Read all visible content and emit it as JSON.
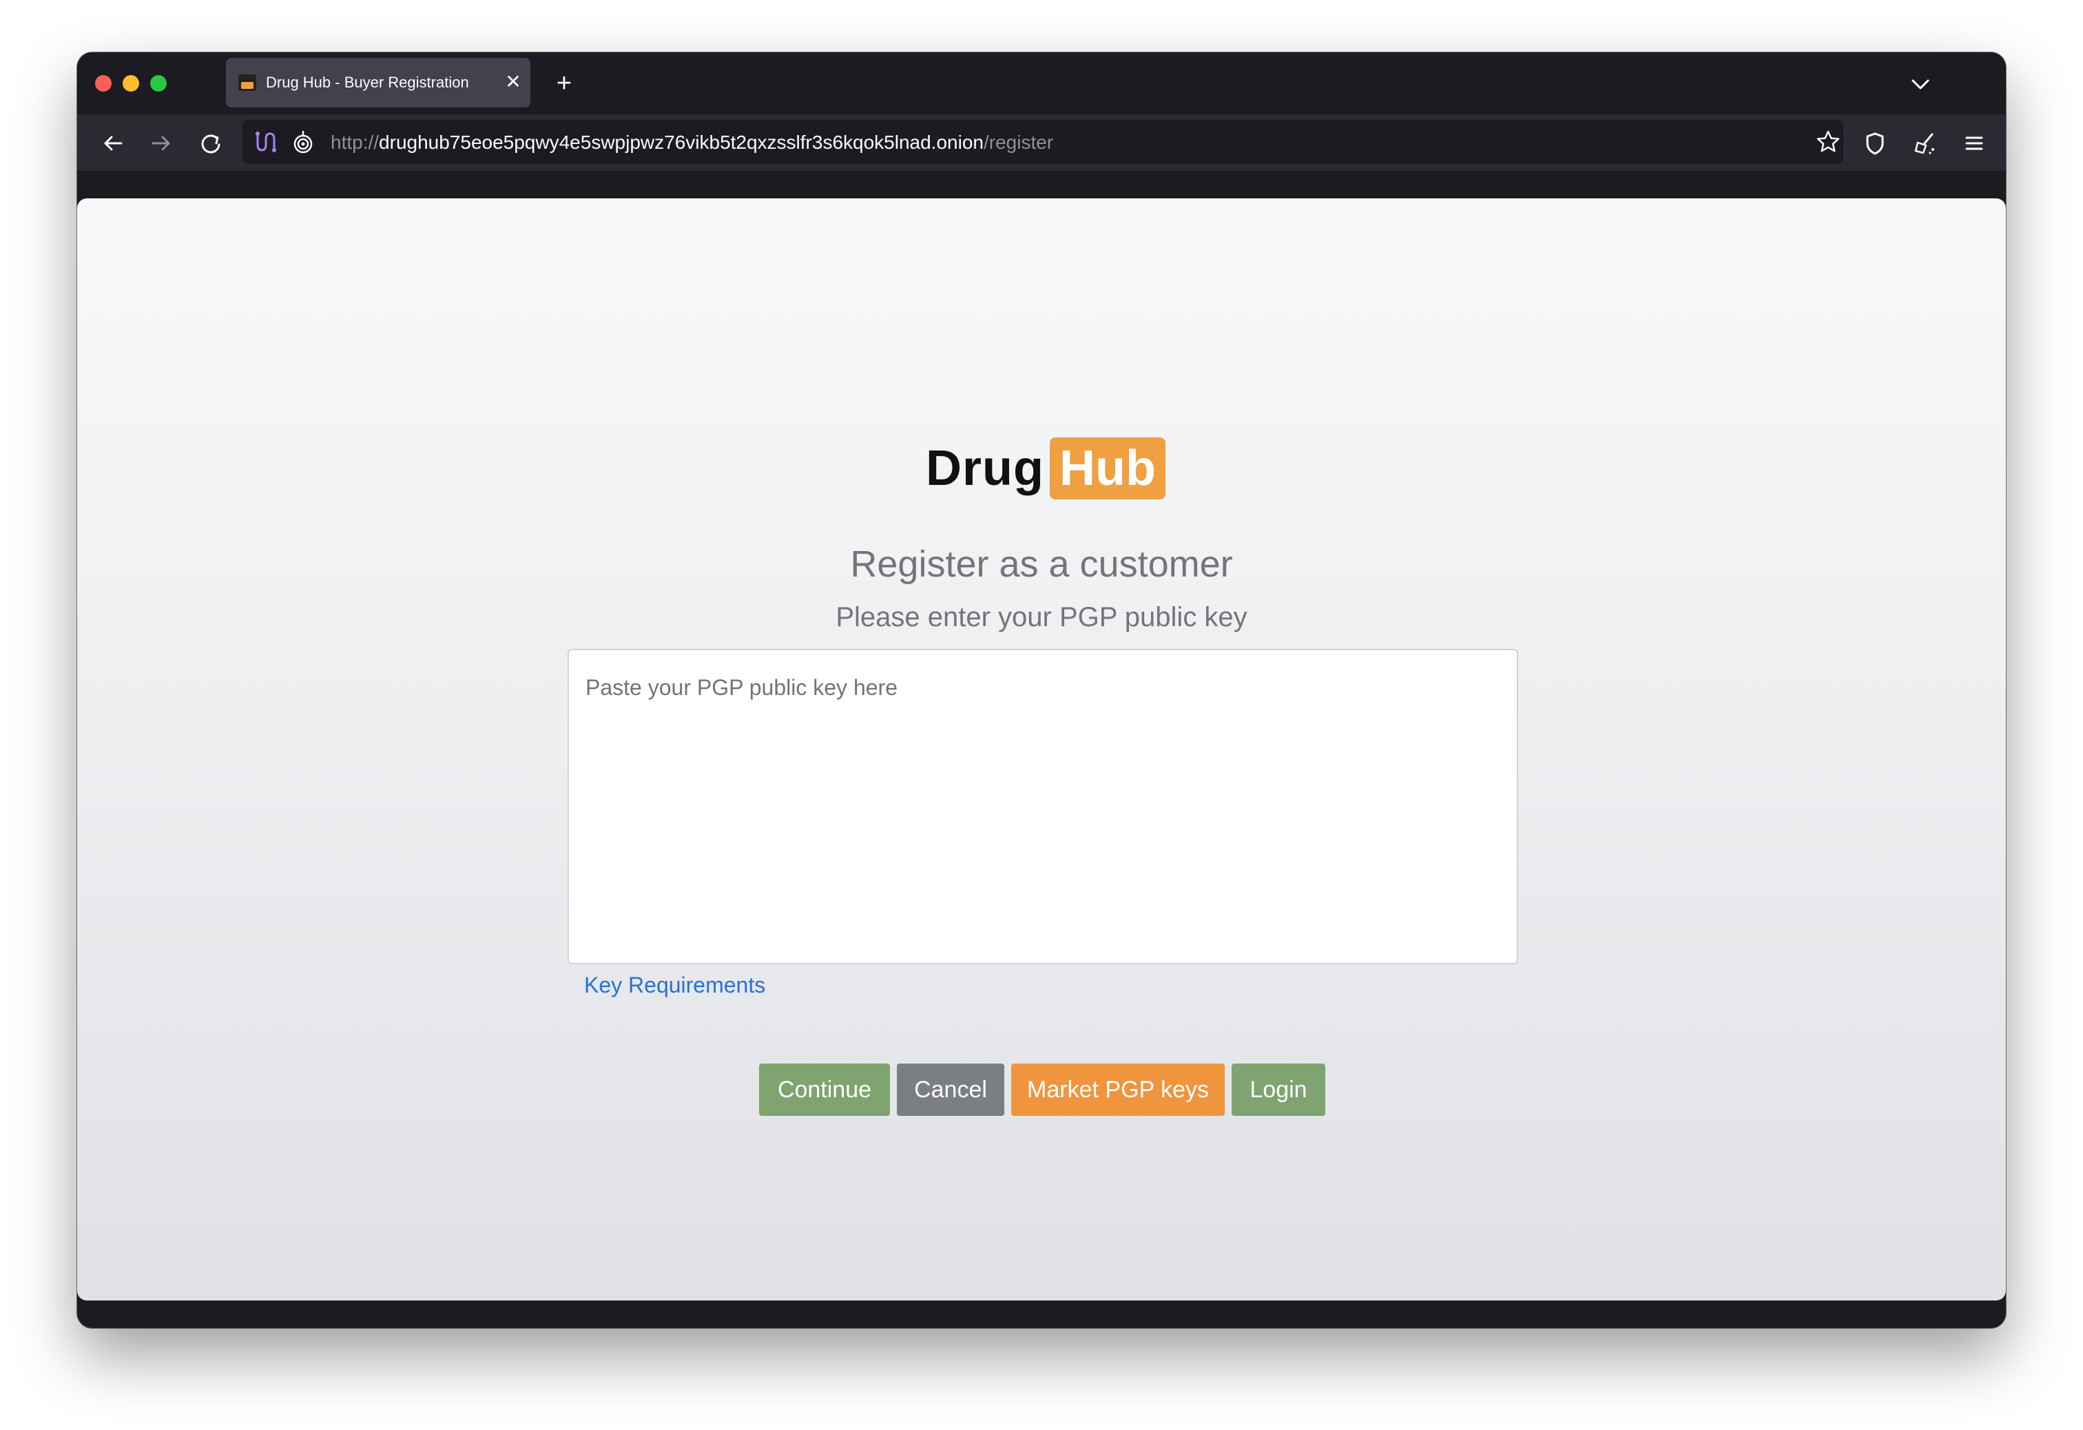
{
  "browser": {
    "tab": {
      "title": "Drug Hub - Buyer Registration",
      "close_symbol": "✕",
      "favicon": "drughub-favicon"
    },
    "new_tab_symbol": "+",
    "url": {
      "scheme": "http://",
      "host": "drughub75eoe5pqwy4e5swpjpwz76vikb5t2qxzsslfr3s6kqok5lnad.onion",
      "path": "/register"
    },
    "icons": {
      "back": "back-arrow-icon",
      "forward": "forward-arrow-icon",
      "reload": "reload-icon",
      "tor_circuit": "tor-circuit-icon",
      "onion": "onion-icon",
      "bookmark": "star-icon",
      "shield": "shield-icon",
      "new_identity": "new-identity-icon",
      "menu": "hamburger-menu-icon",
      "tab_list": "chevron-down-icon"
    }
  },
  "page": {
    "logo": {
      "part1": "Drug",
      "part2": "Hub",
      "accent_color": "#f0a040"
    },
    "heading": "Register as a customer",
    "subheading": "Please enter your PGP public key",
    "textarea": {
      "placeholder": "Paste your PGP public key here",
      "value": ""
    },
    "key_requirements_link": "Key Requirements",
    "buttons": {
      "continue": "Continue",
      "cancel": "Cancel",
      "market_pgp_keys": "Market PGP keys",
      "login": "Login"
    },
    "colors": {
      "continue": "#7fa46f",
      "cancel": "#7b7e82",
      "market": "#f0943d",
      "login": "#7fa46f",
      "link": "#2a6ed8"
    }
  }
}
